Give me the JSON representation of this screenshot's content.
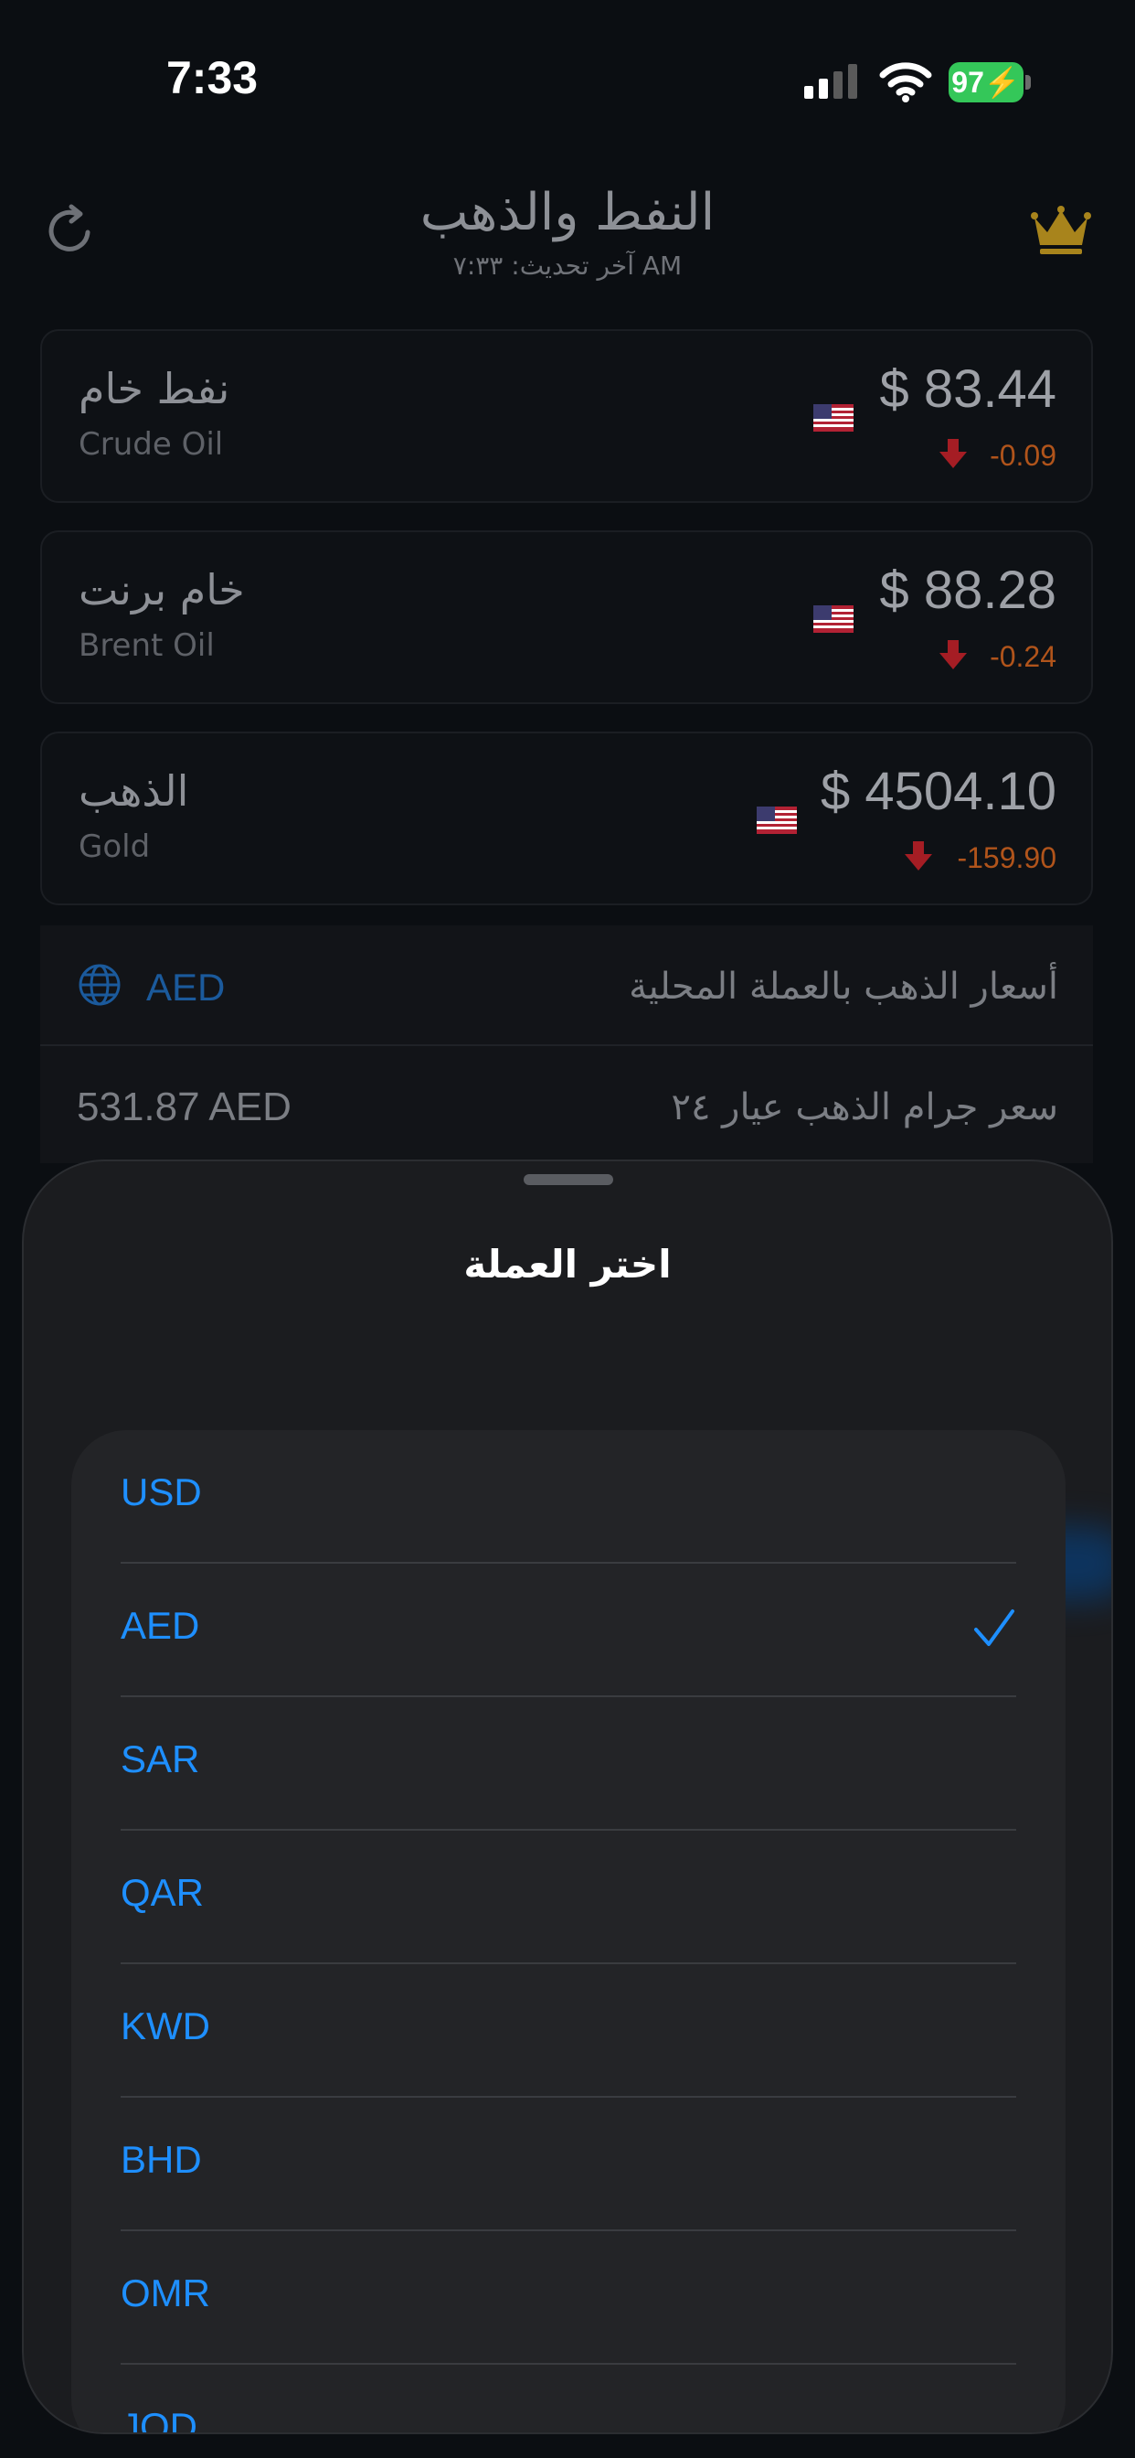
{
  "status_bar": {
    "time": "7:33",
    "battery": "97"
  },
  "header": {
    "title": "النفط والذهب",
    "subtitle": "آخر تحديث: ٧:٣٣ AM"
  },
  "commodities": [
    {
      "ar_name": "نفط خام",
      "en_name": "Crude Oil",
      "price": "$ 83.44",
      "change": "-0.09"
    },
    {
      "ar_name": "خام برنت",
      "en_name": "Brent Oil",
      "price": "$ 88.28",
      "change": "-0.24"
    },
    {
      "ar_name": "الذهب",
      "en_name": "Gold",
      "price": "$ 4504.10",
      "change": "-159.90"
    }
  ],
  "local_prices": {
    "currency": "AED",
    "label": "أسعار الذهب بالعملة المحلية",
    "row_label": "سعر جرام الذهب عيار ٢٤",
    "row_value": "531.87 AED"
  },
  "sheet": {
    "title": "اختر العملة",
    "currencies": [
      "USD",
      "AED",
      "SAR",
      "QAR",
      "KWD",
      "BHD",
      "OMR",
      "JOD"
    ],
    "selected": "AED"
  },
  "colors": {
    "accent": "#1e8fff",
    "negative_change": "#b0541b",
    "down_arrow": "#a51d24",
    "crown": "#a8841c",
    "battery": "#34c759"
  }
}
